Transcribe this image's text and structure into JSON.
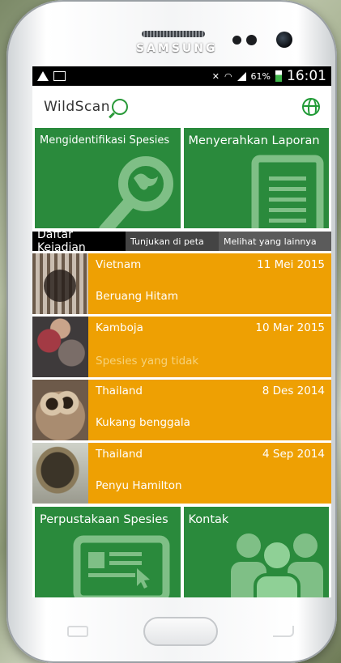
{
  "device": {
    "brand": "SAMSUNG"
  },
  "status_bar": {
    "battery": "61%",
    "time": "16:01"
  },
  "app": {
    "logo_text": "WildScan",
    "globe_icon": "globe-icon",
    "accent": "#2a8a3c",
    "list_color": "#eea003"
  },
  "tiles_top": [
    {
      "label": "Mengidentifikasi Spesies",
      "icon": "magnifier-animal-icon"
    },
    {
      "label": "Menyerahkan Laporan",
      "icon": "document-icon"
    }
  ],
  "tabs": [
    "Daftar Kejadian",
    "Tunjukan di peta",
    "Melihat yang lainnya"
  ],
  "incidents": [
    {
      "country": "Vietnam",
      "date": "11 Mei 2015",
      "species": "Beruang Hitam"
    },
    {
      "country": "Kamboja",
      "date": "10 Mar 2015",
      "species": "Spesies yang tidak"
    },
    {
      "country": "Thailand",
      "date": "8 Des 2014",
      "species": "Kukang benggala"
    },
    {
      "country": "Thailand",
      "date": "4 Sep 2014",
      "species": "Penyu Hamilton"
    }
  ],
  "tiles_bottom": [
    {
      "label": "Perpustakaan Spesies",
      "icon": "computer-screen-icon"
    },
    {
      "label": "Kontak",
      "icon": "people-icon"
    }
  ]
}
